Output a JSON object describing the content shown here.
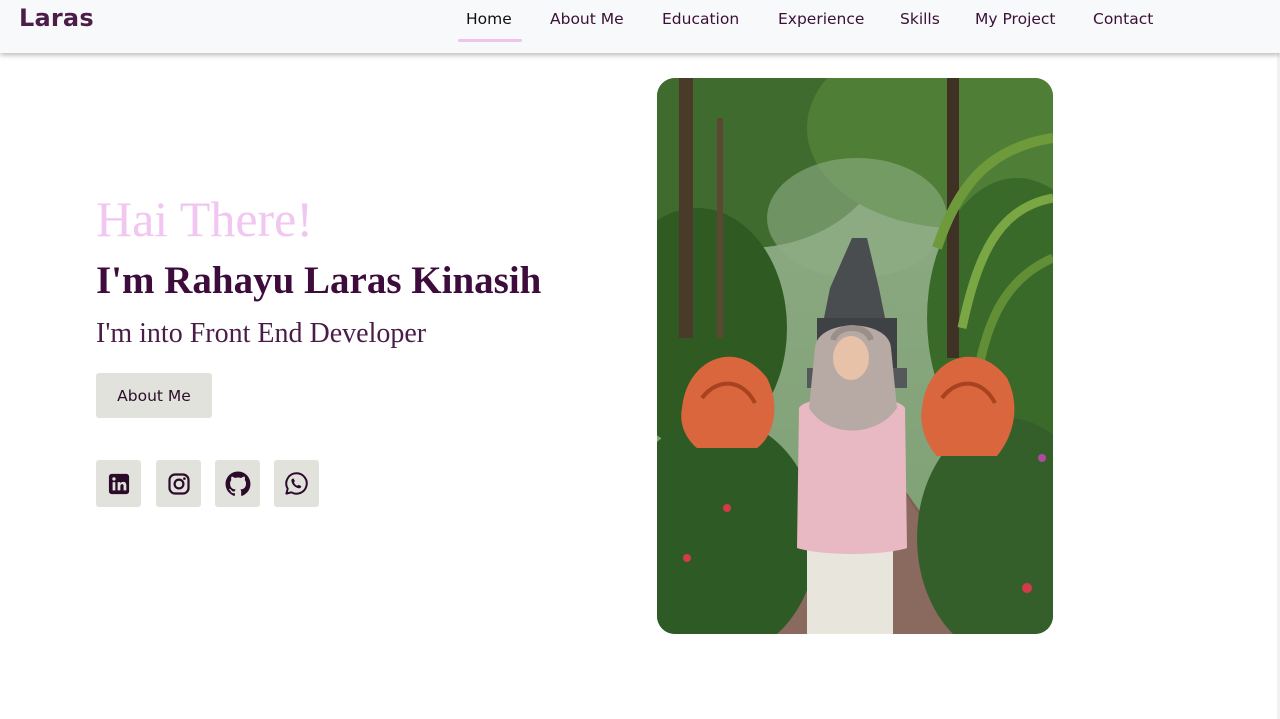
{
  "brand": "Laras",
  "nav": {
    "items": [
      {
        "label": "Home",
        "active": true
      },
      {
        "label": "About Me",
        "active": false
      },
      {
        "label": "Education",
        "active": false
      },
      {
        "label": "Experience",
        "active": false
      },
      {
        "label": "Skills",
        "active": false
      },
      {
        "label": "My Project",
        "active": false
      },
      {
        "label": "Contact",
        "active": false
      }
    ]
  },
  "hero": {
    "greeting": "Hai There!",
    "name": "I'm Rahayu Laras Kinasih",
    "role": "I'm into Front End Developer",
    "button_label": "About Me",
    "socials": [
      {
        "icon": "linkedin-icon"
      },
      {
        "icon": "instagram-icon"
      },
      {
        "icon": "github-icon"
      },
      {
        "icon": "whatsapp-icon"
      }
    ]
  },
  "colors": {
    "brand": "#4b1d48",
    "greeting": "#f1c6f1",
    "name": "#3d0c3c",
    "button_bg": "#e2e2dd",
    "nav_underline": "#f0c2ee"
  }
}
